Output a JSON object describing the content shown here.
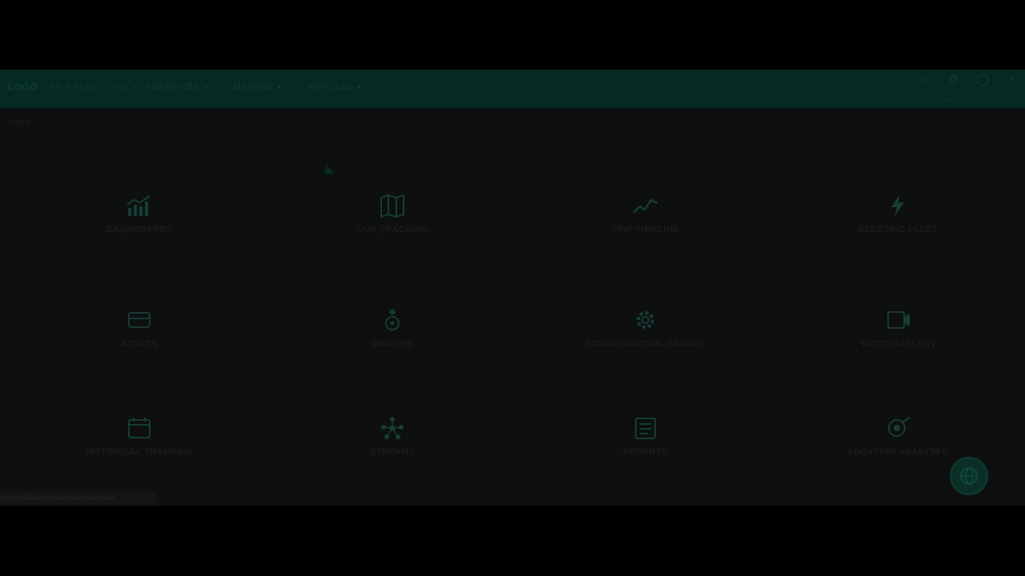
{
  "app": {
    "brand": {
      "name": "LOGO",
      "subtitle": "CAR & FLEET TRACKER"
    },
    "nav": [
      {
        "label": "SERVICES"
      },
      {
        "label": "MANAGE"
      },
      {
        "label": "VEHICLES"
      }
    ],
    "nav_icons": [
      "star-icon",
      "gear-icon",
      "help-icon",
      "logout-icon"
    ],
    "nav_caption": "Welcome, user Dashboard",
    "breadcrumb": "Home",
    "tiles": [
      {
        "label": "DASHBOARDS",
        "icon": "dashboard-chart-icon"
      },
      {
        "label": "LIVE TRACKING",
        "icon": "map-icon"
      },
      {
        "label": "TRIP TIMELINE",
        "icon": "trend-line-icon"
      },
      {
        "label": "ELECTRIC FLEET",
        "icon": "lightning-icon"
      },
      {
        "label": "ASSETS",
        "icon": "truck-icon"
      },
      {
        "label": "DRIVERS",
        "icon": "driver-icon"
      },
      {
        "label": "CONFIGURATION GROUPS",
        "icon": "cog-icon"
      },
      {
        "label": "VIDEO GALLERY",
        "icon": "video-icon"
      },
      {
        "label": "HISTORICAL TRACKING",
        "icon": "calendar-icon"
      },
      {
        "label": "STREAMS",
        "icon": "network-icon"
      },
      {
        "label": "REPORTS",
        "icon": "report-icon"
      },
      {
        "label": "LOCATION ANALYSER",
        "icon": "location-icon"
      }
    ],
    "status_text": "https://app.example.com/tracking/dashboard",
    "colors": {
      "navbar": "#052a22",
      "background": "#0e0f0f",
      "accent": "#0e3f34"
    }
  }
}
